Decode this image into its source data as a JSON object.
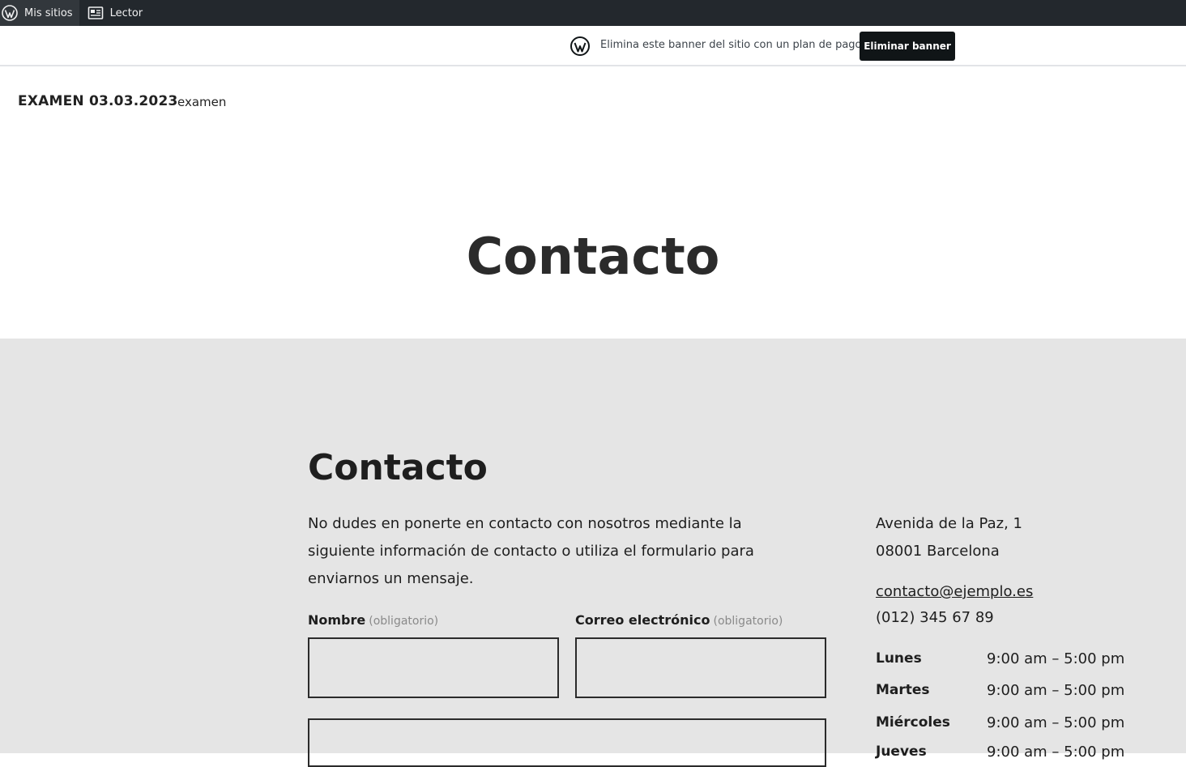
{
  "adminbar": {
    "my_sites_label": "Mis sitios",
    "reader_label": "Lector"
  },
  "banner": {
    "text": "Elimina este banner del sitio con un plan de pago",
    "button_label": "Eliminar banner"
  },
  "site": {
    "title": "EXAMEN 03.03.2023",
    "nav_item": "examen"
  },
  "page": {
    "title": "Contacto"
  },
  "contact": {
    "heading": "Contacto",
    "intro": "No dudes en ponerte en contacto con nosotros mediante la siguiente información de contacto o utiliza el formulario para enviarnos un mensaje.",
    "form": {
      "name_label": "Nombre",
      "email_label": "Correo electrónico",
      "required_text": "(obligatorio)"
    },
    "address_line1": "Avenida de la Paz, 1",
    "address_line2": "08001 Barcelona",
    "email": "contacto@ejemplo.es",
    "phone": "(012) 345 67 89",
    "hours": [
      {
        "day": "Lunes",
        "time": "9:00 am – 5:00 pm"
      },
      {
        "day": "Martes",
        "time": "9:00 am – 5:00 pm"
      },
      {
        "day": "Miércoles",
        "time": "9:00 am – 5:00 pm"
      },
      {
        "day": "Jueves",
        "time": "9:00 am – 5:00 pm"
      }
    ]
  },
  "colors": {
    "adminbar_bg": "#23282d",
    "section_bg": "#e5e5e5",
    "button_bg": "#101517"
  }
}
